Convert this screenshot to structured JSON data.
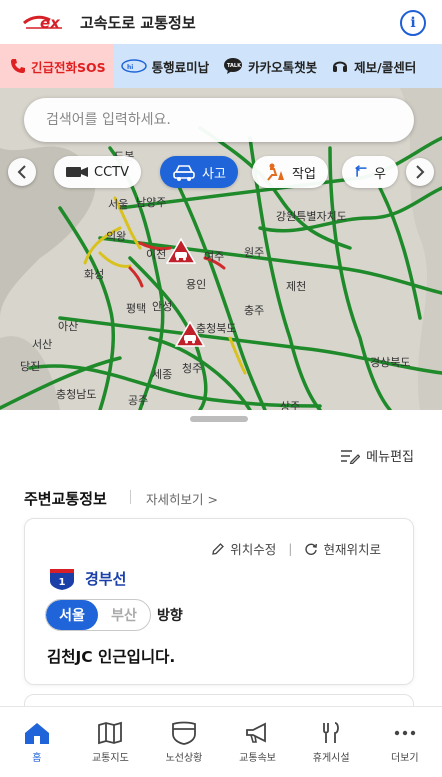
{
  "header": {
    "title": "고속도로 교통정보",
    "logo_icon": "ex-logo",
    "info_icon": "info-icon"
  },
  "quick_menu": [
    {
      "label": "긴급전화SOS",
      "icon": "phone-icon"
    },
    {
      "label": "통행료미납",
      "icon": "hipass-icon"
    },
    {
      "label": "카카오톡챗봇",
      "icon": "talk-icon"
    },
    {
      "label": "제보/콜센터",
      "icon": "headset-icon"
    }
  ],
  "search": {
    "placeholder": "검색어를 입력하세요."
  },
  "map_chips": [
    {
      "label": "CCTV",
      "icon": "camera-icon",
      "active": false
    },
    {
      "label": "사고",
      "icon": "car-crash-icon",
      "active": true
    },
    {
      "label": "작업",
      "icon": "road-work-icon",
      "active": false
    },
    {
      "label": "우",
      "icon": "detour-icon",
      "active": false
    }
  ],
  "map_places": [
    "도봉",
    "서울",
    "남양주",
    "강원특별자치도",
    "원주",
    "여주",
    "이천",
    "화성",
    "제천",
    "평택",
    "안성",
    "충청북도",
    "아산",
    "서산",
    "세종",
    "청주",
    "충청남도",
    "경상북도",
    "공주",
    "상주",
    "의왕",
    "용인",
    "충주",
    "당진"
  ],
  "sheet": {
    "menu_edit": "메뉴편집",
    "section_title": "주변교통정보",
    "detail_link": "자세히보기 >",
    "card": {
      "edit_location": "위치수정",
      "separator": "|",
      "current_location": "현재위치로",
      "route_number": "1",
      "route_name": "경부선",
      "direction_from": "서울",
      "direction_to": "부산",
      "direction_label": "방향",
      "status": "김천JC 인근입니다."
    }
  },
  "bottom_nav": [
    {
      "label": "홈",
      "icon": "home-icon",
      "active": true
    },
    {
      "label": "교통지도",
      "icon": "map-icon",
      "active": false
    },
    {
      "label": "노선상황",
      "icon": "route-shield-icon",
      "active": false
    },
    {
      "label": "교통속보",
      "icon": "megaphone-icon",
      "active": false
    },
    {
      "label": "휴게시설",
      "icon": "rest-area-icon",
      "active": false
    },
    {
      "label": "더보기",
      "icon": "more-icon",
      "active": false
    }
  ],
  "colors": {
    "accent": "#1f64d8",
    "sos": "#e02020",
    "quick_bg": "#cfe4fb",
    "road": "#1e8a2a"
  }
}
